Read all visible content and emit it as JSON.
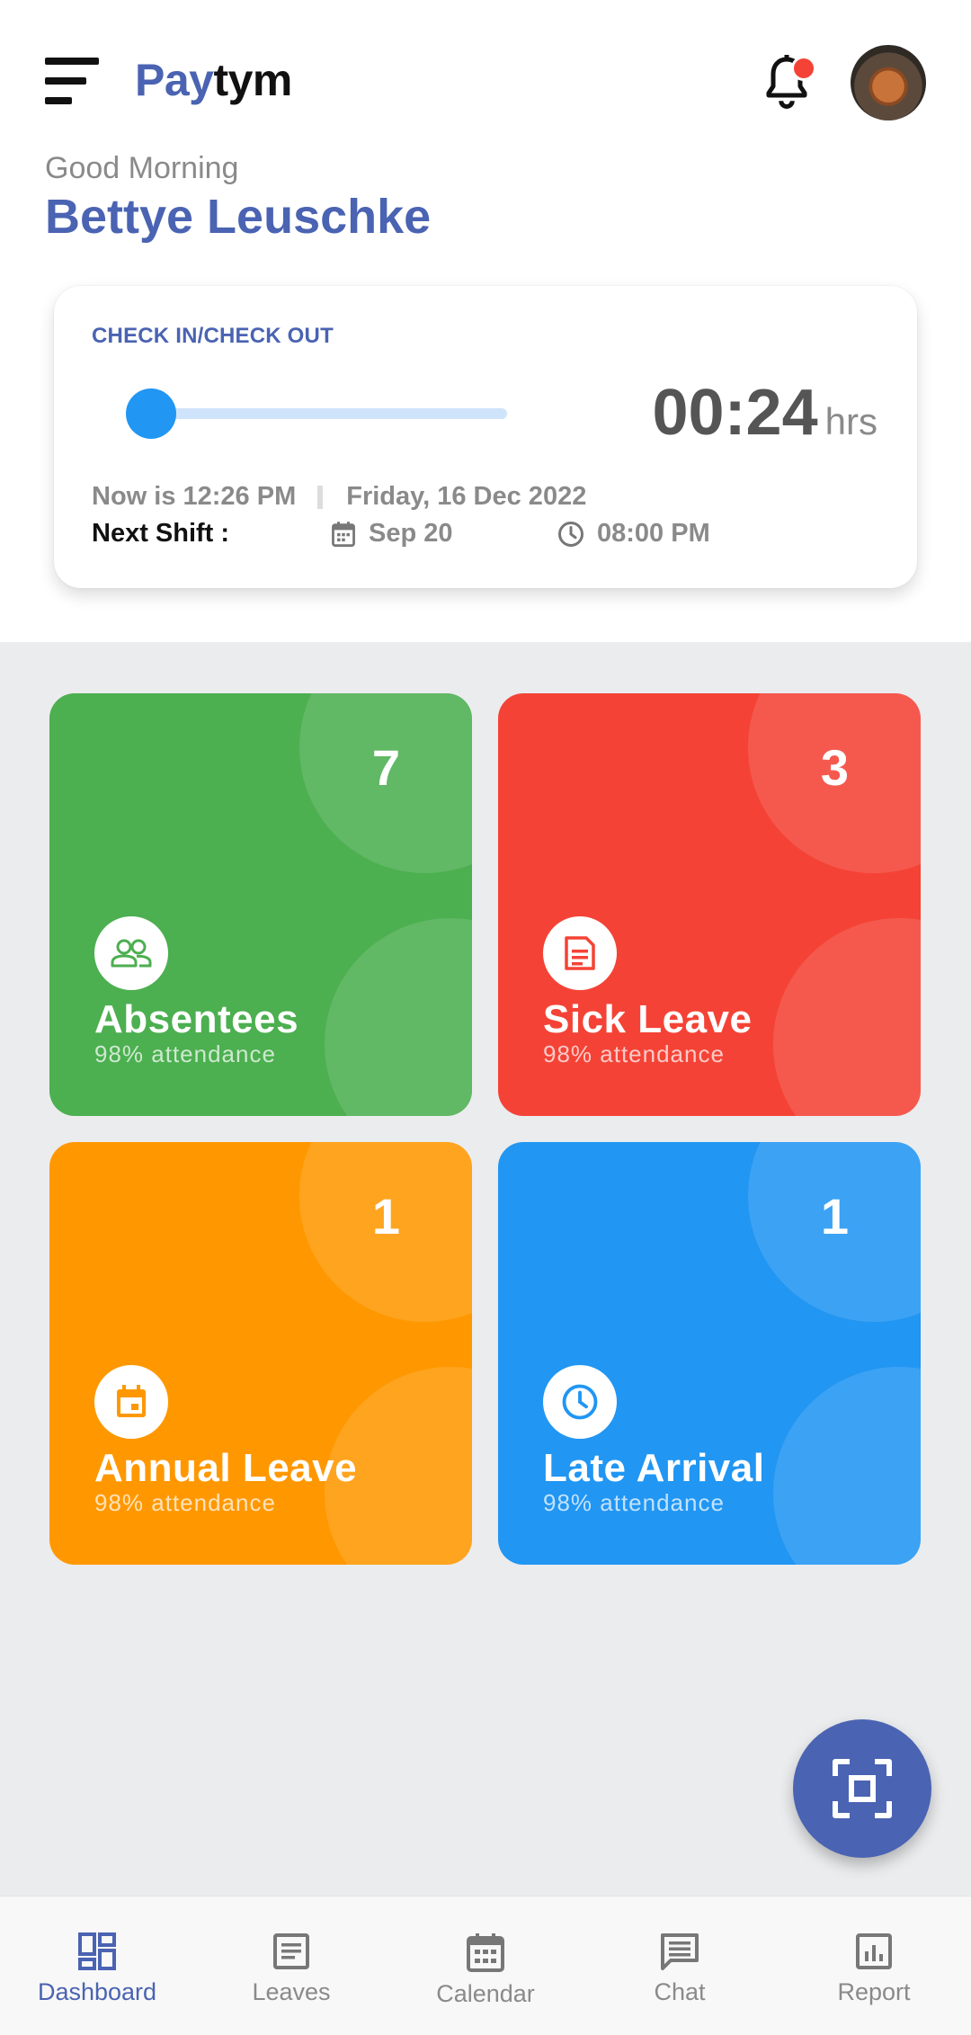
{
  "header": {
    "brand_part1": "Pay",
    "brand_part2": "tym",
    "greeting": "Good Morning",
    "user_name": "Bettye Leuschke",
    "icons": [
      "menu-icon",
      "bell-icon",
      "avatar"
    ]
  },
  "checkin": {
    "title": "CHECK IN/CHECK OUT",
    "timer_value": "00:24",
    "timer_unit": "hrs",
    "now_text": "Now is 12:26 PM",
    "date_text": "Friday, 16 Dec 2022",
    "next_shift_label": "Next Shift :",
    "next_shift_date": "Sep 20",
    "next_shift_time": "08:00 PM",
    "slider_progress": 0.0
  },
  "tiles": [
    {
      "count": "7",
      "title": "Absentees",
      "subtitle": "98% attendance",
      "icon": "people-icon",
      "color": "#4caf50"
    },
    {
      "count": "3",
      "title": "Sick Leave",
      "subtitle": "98% attendance",
      "icon": "document-icon",
      "color": "#f44336"
    },
    {
      "count": "1",
      "title": "Annual Leave",
      "subtitle": "98% attendance",
      "icon": "calendar-icon",
      "color": "#ff9800"
    },
    {
      "count": "1",
      "title": "Late Arrival",
      "subtitle": "98% attendance",
      "icon": "clock-icon",
      "color": "#2196f3"
    }
  ],
  "fab": {
    "icon": "scan-icon"
  },
  "nav": [
    {
      "label": "Dashboard",
      "icon": "dashboard-icon",
      "active": true
    },
    {
      "label": "Leaves",
      "icon": "leaves-icon",
      "active": false
    },
    {
      "label": "Calendar",
      "icon": "calendar-icon",
      "active": false
    },
    {
      "label": "Chat",
      "icon": "chat-icon",
      "active": false
    },
    {
      "label": "Report",
      "icon": "report-icon",
      "active": false
    }
  ],
  "colors": {
    "primary": "#4a63b2",
    "accent_blue": "#2196f3",
    "notification": "#f44336",
    "background": "#ebecee"
  }
}
